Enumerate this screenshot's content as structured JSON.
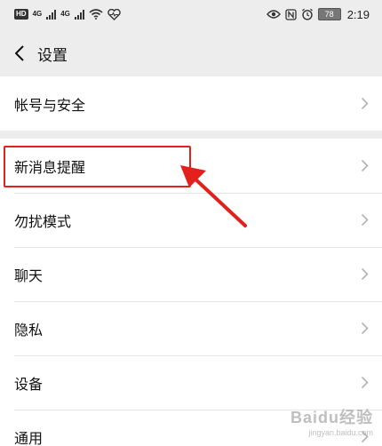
{
  "status_bar": {
    "hd_label": "HD",
    "network_1": "4G",
    "network_2": "4G",
    "battery": "78",
    "time": "2:19",
    "icons": [
      "hd-badge-icon",
      "signal-icon",
      "signal-icon",
      "wifi-icon",
      "heart-health-icon",
      "eye-icon",
      "nfc-icon",
      "alarm-icon",
      "battery-icon"
    ]
  },
  "header": {
    "title": "设置",
    "back_icon": "chevron-left-icon"
  },
  "sections": [
    {
      "items": [
        {
          "label": "帐号与安全"
        }
      ]
    },
    {
      "items": [
        {
          "label": "新消息提醒"
        },
        {
          "label": "勿扰模式"
        },
        {
          "label": "聊天"
        },
        {
          "label": "隐私"
        },
        {
          "label": "设备"
        },
        {
          "label": "通用"
        }
      ]
    }
  ],
  "annotation": {
    "color": "#e3201b"
  },
  "watermark": {
    "brand": "Baidu经验",
    "domain": "jingyan.baidu.com"
  },
  "colors": {
    "background": "#ededed",
    "list_bg": "#ffffff",
    "chevron": "#b2b2b2"
  }
}
